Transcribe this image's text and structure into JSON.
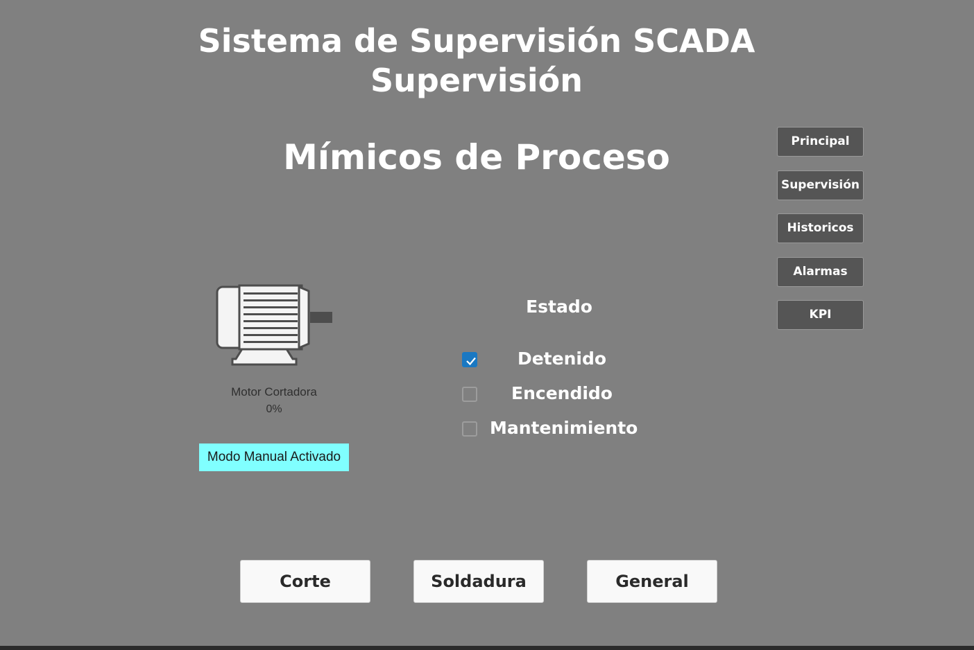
{
  "header": {
    "title_line1": "Sistema de Supervisión SCADA",
    "title_line2": "Supervisión",
    "section_title": "Mímicos de Proceso"
  },
  "nav": {
    "items": [
      {
        "label": "Principal"
      },
      {
        "label": "Supervisión"
      },
      {
        "label": "Historicos"
      },
      {
        "label": "Alarmas"
      },
      {
        "label": "KPI"
      }
    ]
  },
  "motor": {
    "icon": "motor-icon",
    "name": "Motor Cortadora",
    "value": "0%",
    "mode_badge": "Modo Manual Activado",
    "mode_badge_color": "#80ffff"
  },
  "estado": {
    "title": "Estado",
    "options": [
      {
        "label": "Detenido",
        "checked": true
      },
      {
        "label": "Encendido",
        "checked": false
      },
      {
        "label": "Mantenimiento",
        "checked": false
      }
    ],
    "check_color": "#1a78c2"
  },
  "process_buttons": [
    {
      "label": "Corte"
    },
    {
      "label": "Soldadura"
    },
    {
      "label": "General"
    }
  ],
  "colors": {
    "background": "#808080",
    "nav_button": "#555555",
    "text": "#ffffff"
  }
}
